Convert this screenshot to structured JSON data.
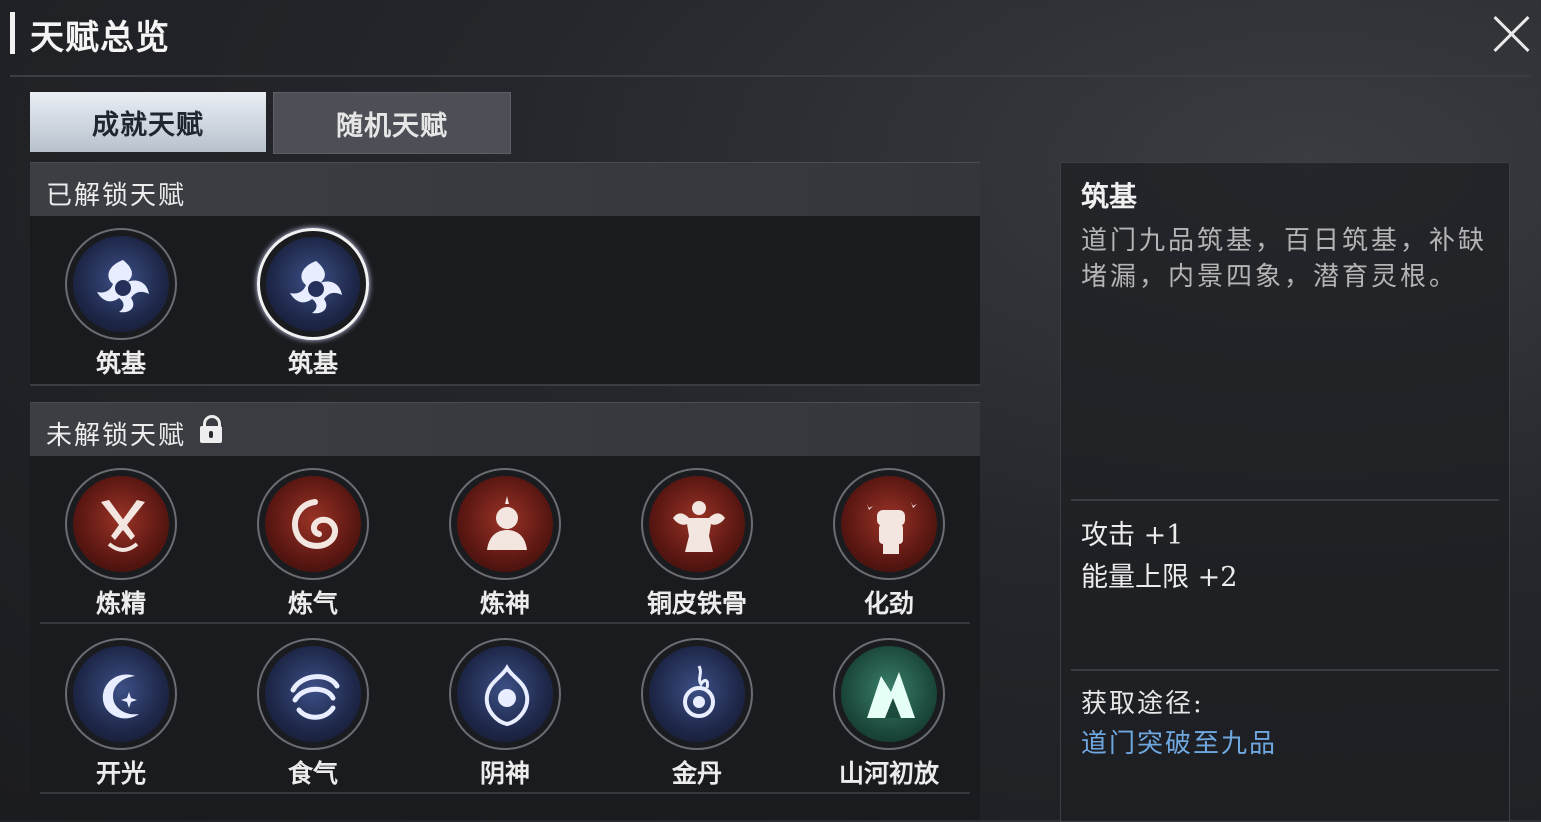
{
  "header": {
    "title": "天赋总览"
  },
  "tabs": [
    {
      "label": "成就天赋",
      "active": true
    },
    {
      "label": "随机天赋",
      "active": false
    }
  ],
  "unlocked": {
    "heading": "已解锁天赋",
    "items": [
      {
        "name": "筑基",
        "icon": "foundation-icon",
        "color": "blue"
      },
      {
        "name": "筑基",
        "icon": "foundation-icon",
        "color": "blue",
        "selected": true
      }
    ]
  },
  "locked": {
    "heading": "未解锁天赋",
    "items": [
      {
        "name": "炼精",
        "icon": "crossed-swords-icon",
        "color": "red"
      },
      {
        "name": "炼气",
        "icon": "swirl-icon",
        "color": "red"
      },
      {
        "name": "炼神",
        "icon": "meditating-figure-icon",
        "color": "red"
      },
      {
        "name": "铜皮铁骨",
        "icon": "muscle-figure-icon",
        "color": "red"
      },
      {
        "name": "化劲",
        "icon": "fist-icon",
        "color": "red"
      },
      {
        "name": "开光",
        "icon": "crescent-star-icon",
        "color": "blue"
      },
      {
        "name": "食气",
        "icon": "whirlwind-icon",
        "color": "blue"
      },
      {
        "name": "阴神",
        "icon": "spirit-icon",
        "color": "blue"
      },
      {
        "name": "金丹",
        "icon": "golden-core-icon",
        "color": "blue"
      },
      {
        "name": "山河初放",
        "icon": "mountain-icon",
        "color": "teal"
      }
    ]
  },
  "detail": {
    "title": "筑基",
    "description": "道门九品筑基，百日筑基，补缺堵漏，内景四象，潜育灵根。",
    "stats": [
      "攻击 +1",
      "能量上限 +2"
    ],
    "source_label": "获取途径:",
    "source_value": "道门突破至九品"
  }
}
